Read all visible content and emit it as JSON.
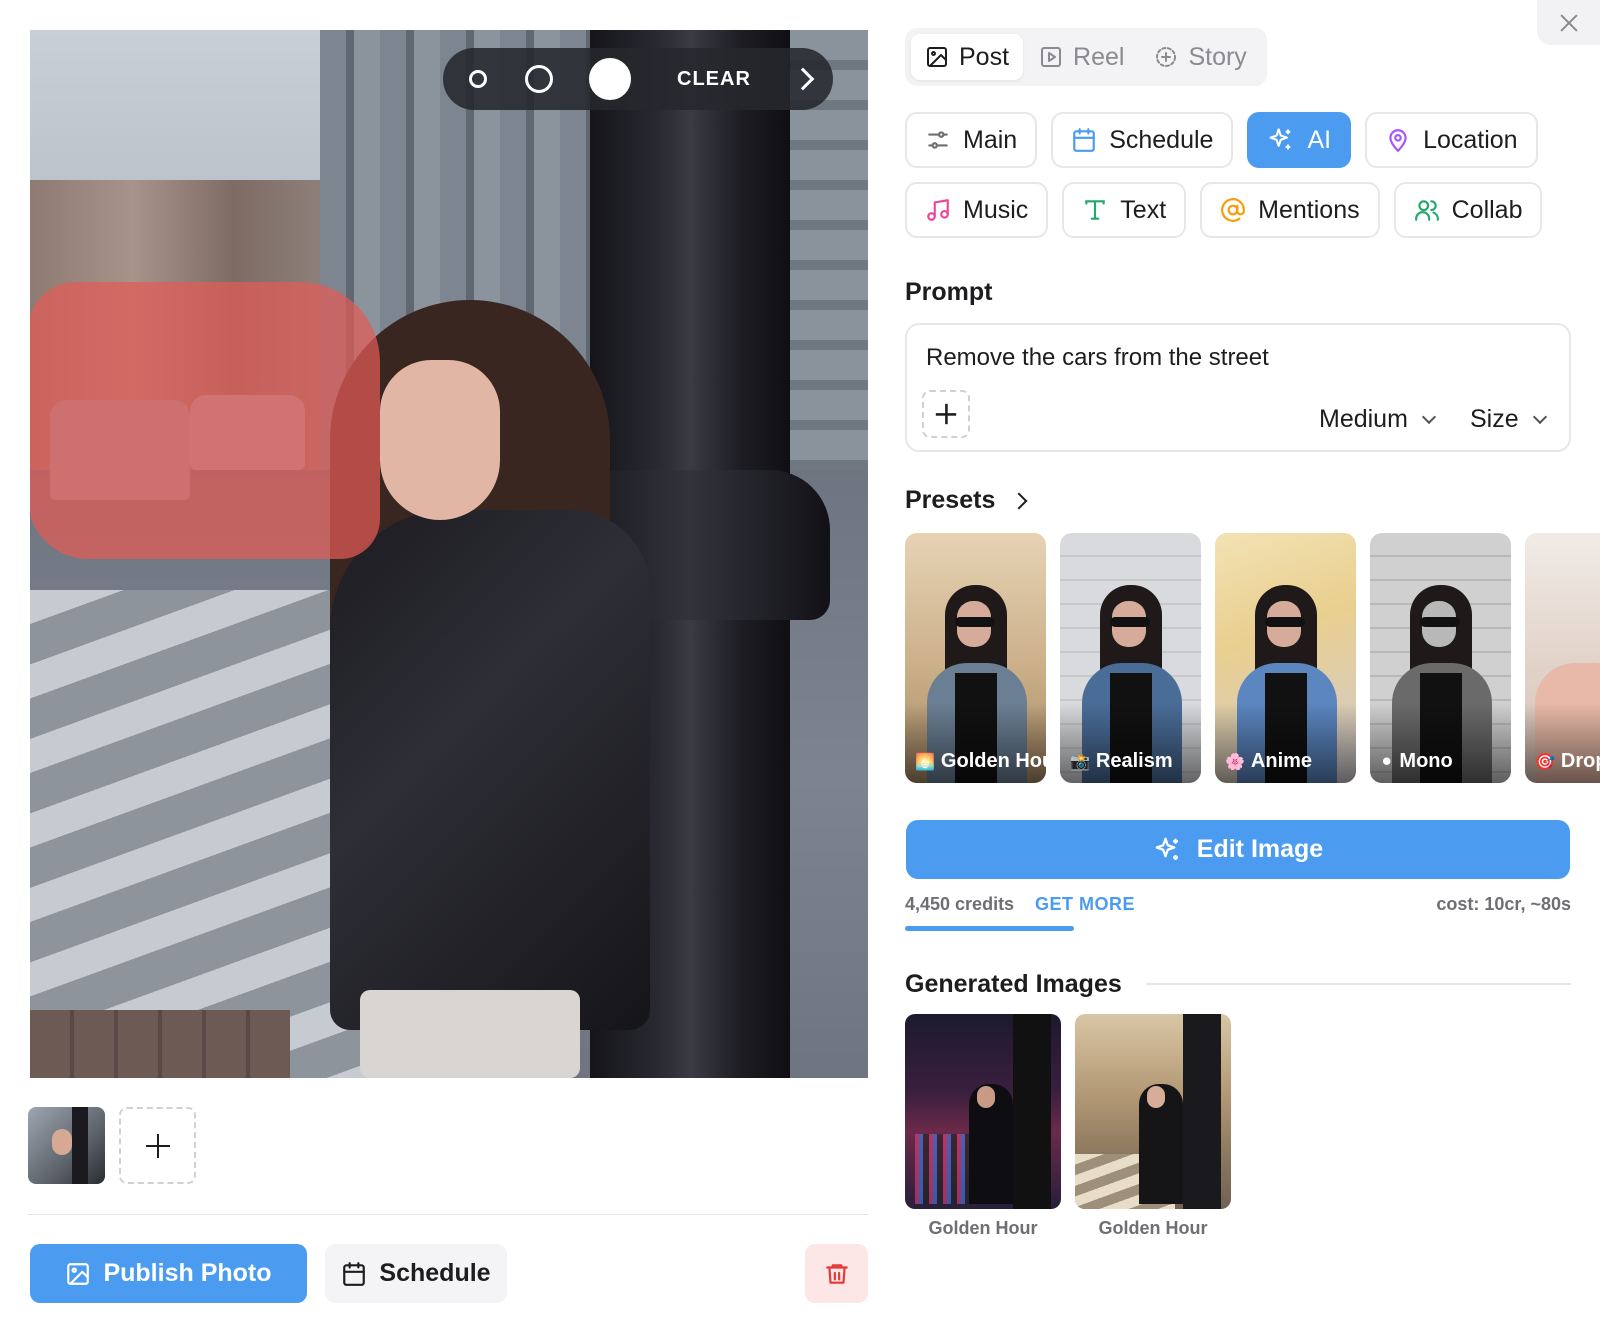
{
  "brush_toolbar": {
    "clear_label": "CLEAR"
  },
  "post_types": [
    {
      "label": "Post",
      "active": true,
      "icon": "image-icon"
    },
    {
      "label": "Reel",
      "active": false,
      "icon": "play-square-icon"
    },
    {
      "label": "Story",
      "active": false,
      "icon": "story-plus-icon"
    }
  ],
  "feature_tabs": [
    {
      "label": "Main",
      "icon": "sliders-icon",
      "active": false
    },
    {
      "label": "Schedule",
      "icon": "calendar-icon",
      "active": false
    },
    {
      "label": "AI",
      "icon": "sparkles-icon",
      "active": true
    },
    {
      "label": "Location",
      "icon": "map-pin-icon",
      "active": false
    },
    {
      "label": "Music",
      "icon": "music-note-icon",
      "active": false
    },
    {
      "label": "Text",
      "icon": "text-t-icon",
      "active": false
    },
    {
      "label": "Mentions",
      "icon": "at-sign-icon",
      "active": false
    },
    {
      "label": "Collab",
      "icon": "users-icon",
      "active": false
    }
  ],
  "prompt": {
    "label": "Prompt",
    "value": "Remove the cars from the street",
    "quality": "Medium",
    "size": "Size"
  },
  "presets": {
    "label": "Presets",
    "items": [
      {
        "label": "Golden Hour",
        "emoji": "🌅"
      },
      {
        "label": "Realism",
        "emoji": "📸"
      },
      {
        "label": "Anime",
        "emoji": "🌸"
      },
      {
        "label": "Mono",
        "emoji": "⚫"
      },
      {
        "label": "Drop C",
        "emoji": "🎯"
      }
    ]
  },
  "edit_button": {
    "label": "Edit Image"
  },
  "credits": {
    "amount": "4,450 credits",
    "get_more": "GET MORE",
    "cost": "cost: 10cr, ~80s"
  },
  "generated": {
    "label": "Generated Images",
    "items": [
      {
        "caption": "Golden Hour"
      },
      {
        "caption": "Golden Hour"
      }
    ]
  },
  "footer": {
    "publish_label": "Publish Photo",
    "schedule_label": "Schedule"
  },
  "colors": {
    "accent": "#4b9cf0",
    "mask": "#e25c56",
    "danger_bg": "#fde6e6",
    "danger": "#e53935"
  }
}
